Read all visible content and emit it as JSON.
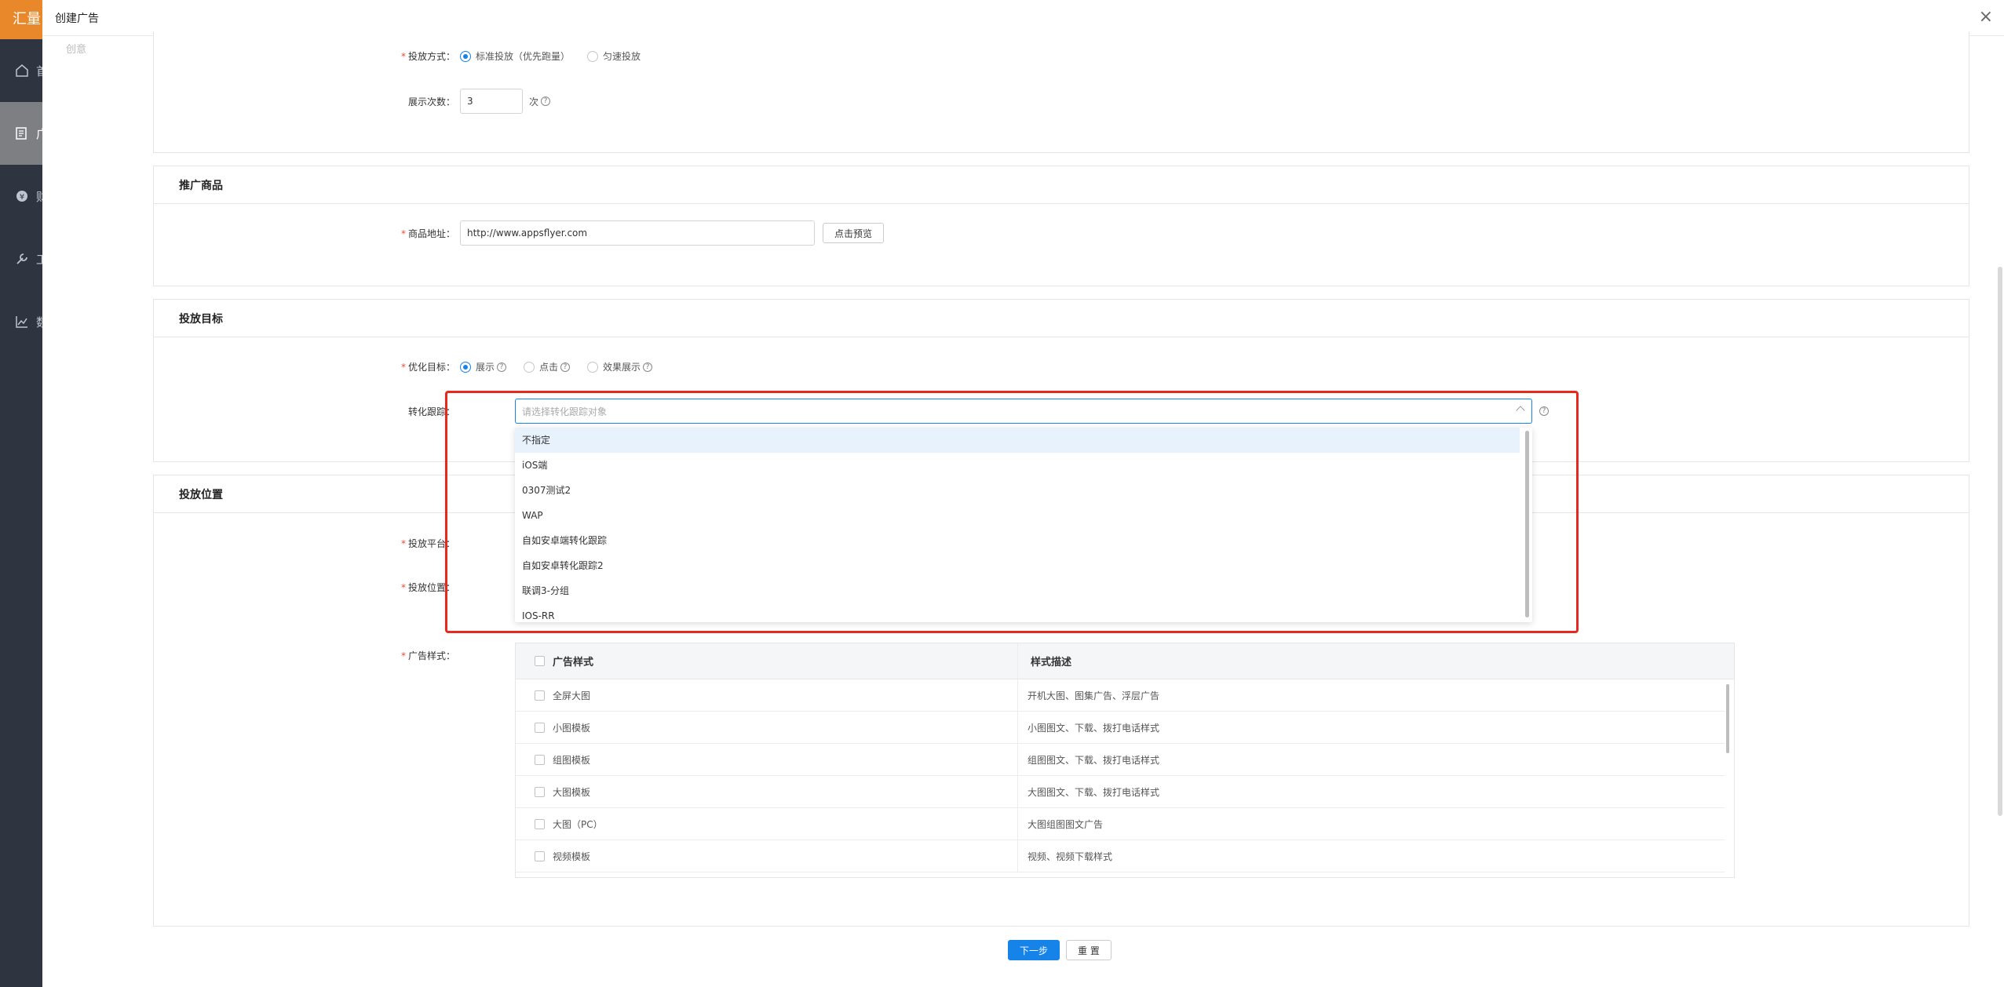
{
  "sidebar": {
    "brand": "汇量",
    "items": [
      {
        "icon": "home-icon",
        "label": "首页"
      },
      {
        "icon": "ad-list-icon",
        "label": "广告"
      },
      {
        "icon": "finance-icon",
        "label": "财务"
      },
      {
        "icon": "tools-icon",
        "label": "工具"
      },
      {
        "icon": "chart-icon",
        "label": "数据"
      }
    ]
  },
  "drawer": {
    "title": "创建广告",
    "close": "×",
    "step": "创意"
  },
  "delivery": {
    "method_label": "投放方式：",
    "method_options": [
      "标准投放（优先跑量）",
      "匀速投放"
    ],
    "impressions_label": "展示次数：",
    "impressions_value": "3",
    "impressions_unit": "次"
  },
  "product": {
    "section_title": "推广商品",
    "url_label": "商品地址：",
    "url_value": "http://www.appsflyer.com",
    "preview_button": "点击预览"
  },
  "goal": {
    "section_title": "投放目标",
    "optimize_label": "优化目标：",
    "optimize_options": [
      "展示",
      "点击",
      "效果展示"
    ],
    "tracking_label": "转化跟踪：",
    "tracking_placeholder": "请选择转化跟踪对象",
    "tracking_options": [
      "不指定",
      "iOS端",
      "0307测试2",
      "WAP",
      "自如安卓端转化跟踪",
      "自如安卓转化跟踪2",
      "联调3-分组",
      "IOS-RR"
    ]
  },
  "placement": {
    "section_title": "投放位置",
    "platform_label": "投放平台：",
    "position_label": "投放位置：",
    "style_label": "广告样式：",
    "table_headers": [
      "广告样式",
      "样式描述"
    ],
    "rows": [
      {
        "style": "全屏大图",
        "desc": "开机大图、图集广告、浮层广告"
      },
      {
        "style": "小图模板",
        "desc": "小图图文、下载、拨打电话样式"
      },
      {
        "style": "组图模板",
        "desc": "组图图文、下载、拨打电话样式"
      },
      {
        "style": "大图模板",
        "desc": "大图图文、下载、拨打电话样式"
      },
      {
        "style": "大图（PC）",
        "desc": "大图组图图文广告"
      },
      {
        "style": "视频模板",
        "desc": "视频、视频下载样式"
      }
    ]
  },
  "footer": {
    "next_button": "下一步",
    "reset_button": "重 置"
  },
  "colors": {
    "accent": "#1683e8",
    "highlight_border": "#e8281e",
    "required": "#e74c3c",
    "brand": "#e8882a"
  }
}
